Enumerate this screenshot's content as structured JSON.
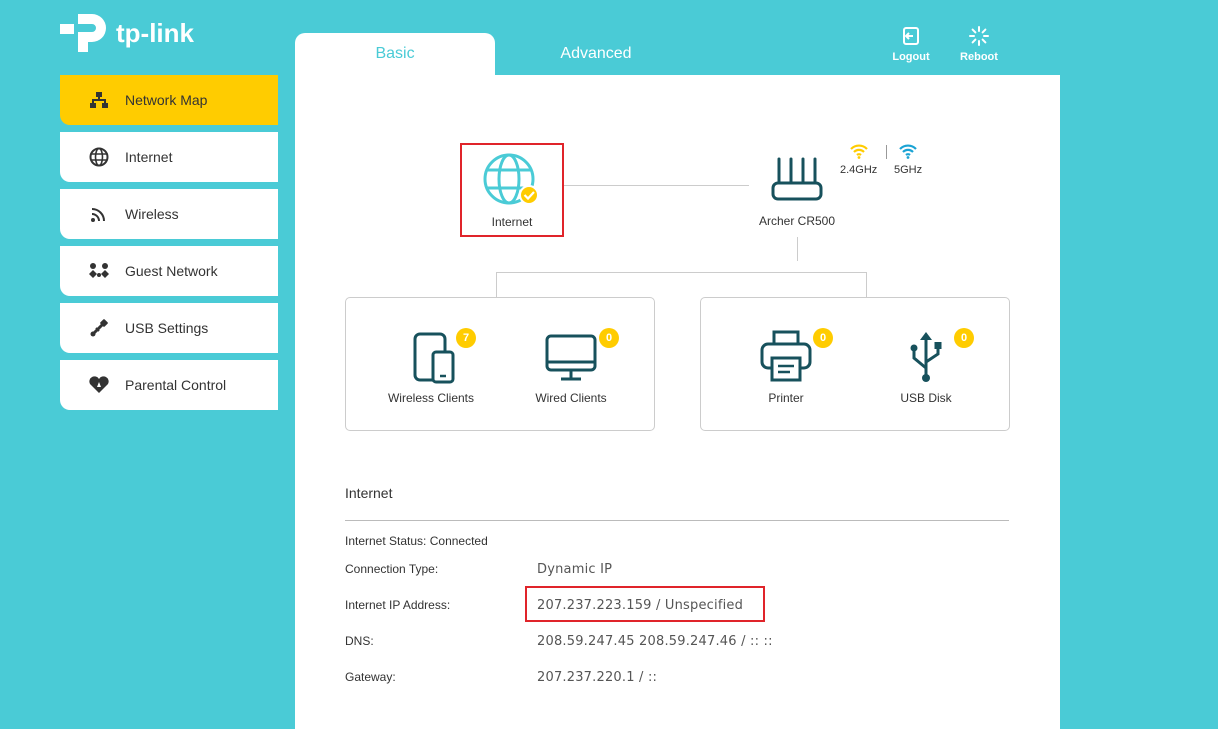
{
  "brand": {
    "name": "tp-link",
    "accent": "#4acbd6",
    "active": "#ffcc00",
    "highlight": "#e0242a"
  },
  "tabs": [
    {
      "label": "Basic"
    },
    {
      "label": "Advanced"
    }
  ],
  "top_actions": {
    "logout": "Logout",
    "reboot": "Reboot"
  },
  "sidebar": {
    "items": [
      {
        "label": "Network Map",
        "icon": "network-map-icon",
        "active": true
      },
      {
        "label": "Internet",
        "icon": "globe-icon"
      },
      {
        "label": "Wireless",
        "icon": "wireless-icon"
      },
      {
        "label": "Guest Network",
        "icon": "guest-network-icon"
      },
      {
        "label": "USB Settings",
        "icon": "usb-settings-icon"
      },
      {
        "label": "Parental Control",
        "icon": "parental-control-icon"
      }
    ]
  },
  "map": {
    "internet_label": "Internet",
    "router_label": "Archer CR500",
    "band_24": "2.4GHz",
    "band_5": "5GHz",
    "clients": [
      {
        "label": "Wireless Clients",
        "count": "7"
      },
      {
        "label": "Wired Clients",
        "count": "0"
      },
      {
        "label": "Printer",
        "count": "0"
      },
      {
        "label": "USB Disk",
        "count": "0"
      }
    ]
  },
  "info": {
    "title": "Internet",
    "status_label": "Internet Status:",
    "status_value": "Connected",
    "conn_type_label": "Connection Type:",
    "conn_type_value": "Dynamic IP",
    "ip_label": "Internet IP Address:",
    "ip_value": "207.237.223.159 / Unspecified",
    "dns_label": "DNS:",
    "dns_value": "208.59.247.45 208.59.247.46 / :: ::",
    "gateway_label": "Gateway:",
    "gateway_value": "207.237.220.1 / ::"
  }
}
